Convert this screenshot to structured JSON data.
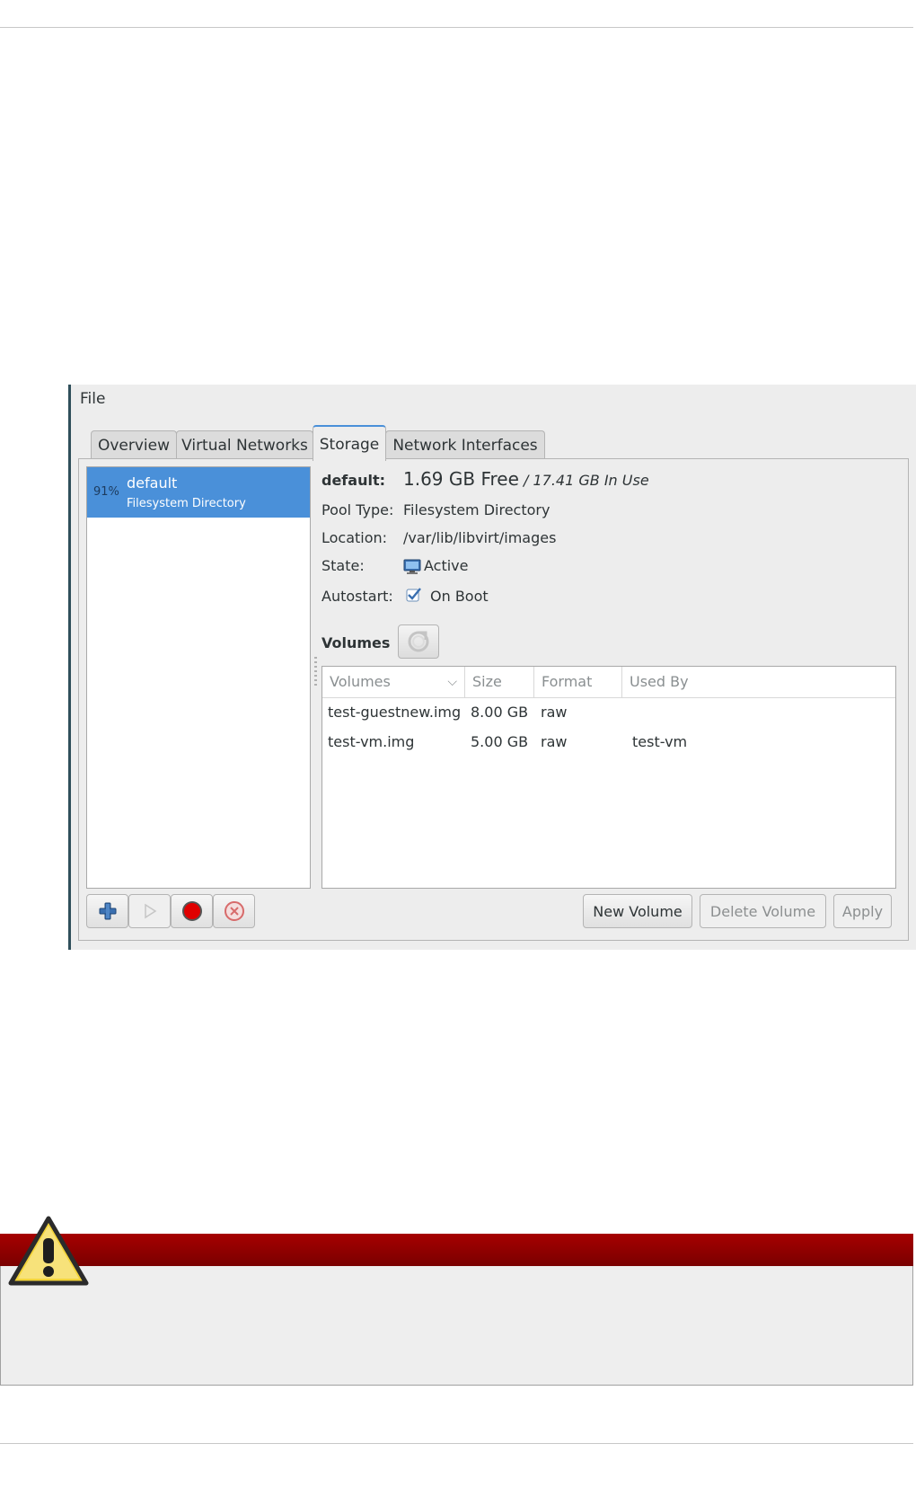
{
  "window": {
    "menu": [
      "File"
    ],
    "tabs": [
      {
        "label": "Overview",
        "active": false
      },
      {
        "label": "Virtual Networks",
        "active": false
      },
      {
        "label": "Storage",
        "active": true
      },
      {
        "label": "Network Interfaces",
        "active": false
      }
    ],
    "pools": [
      {
        "percent": "91%",
        "name": "default",
        "type": "Filesystem Directory",
        "selected": true
      }
    ],
    "details": {
      "name_label": "default:",
      "free": "1.69 GB Free",
      "in_use": "/ 17.41 GB In Use",
      "pool_type_label": "Pool Type:",
      "pool_type": "Filesystem Directory",
      "location_label": "Location:",
      "location": "/var/lib/libvirt/images",
      "state_label": "State:",
      "state": "Active",
      "state_icon": "monitor-icon",
      "autostart_label": "Autostart:",
      "autostart": "On Boot",
      "autostart_checked": true,
      "volumes_label": "Volumes",
      "refresh_icon": "refresh-icon"
    },
    "volumes_table": {
      "columns": [
        "Volumes",
        "Size",
        "Format",
        "Used By"
      ],
      "rows": [
        {
          "name": "test-guestnew.img",
          "size": "8.00 GB",
          "format": "raw",
          "used_by": ""
        },
        {
          "name": "test-vm.img",
          "size": "5.00 GB",
          "format": "raw",
          "used_by": "test-vm"
        }
      ]
    },
    "pool_buttons": [
      {
        "icon": "add-icon",
        "enabled": true
      },
      {
        "icon": "play-icon",
        "enabled": false
      },
      {
        "icon": "stop-icon",
        "enabled": true
      },
      {
        "icon": "delete-icon",
        "enabled": true
      }
    ],
    "buttons": {
      "new_volume": "New Volume",
      "delete_volume": "Delete Volume",
      "apply": "Apply"
    }
  },
  "warning": {
    "icon": "warning-icon",
    "colors": {
      "bar": "#8b0000",
      "body": "#eeeeee"
    }
  }
}
